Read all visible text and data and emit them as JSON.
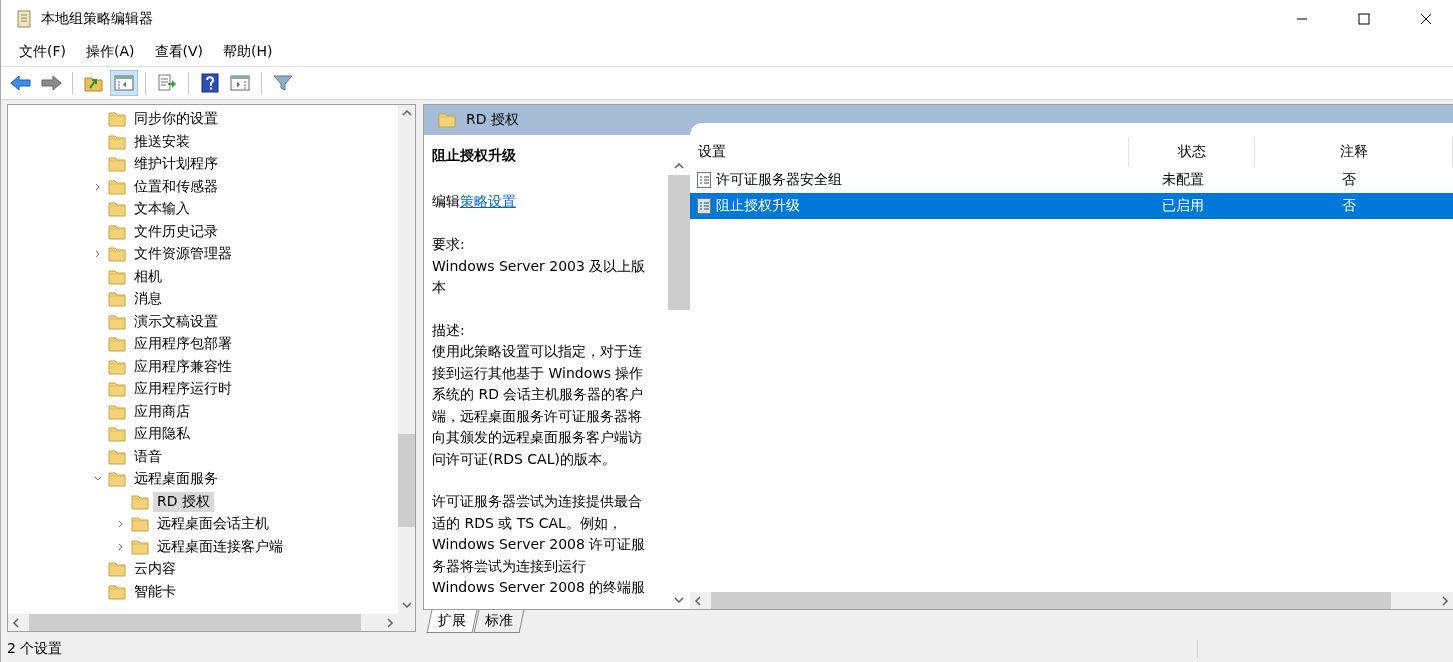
{
  "window": {
    "title": "本地组策略编辑器"
  },
  "menu": [
    "文件(F)",
    "操作(A)",
    "查看(V)",
    "帮助(H)"
  ],
  "toolbar": [
    {
      "kind": "back",
      "pressed": false
    },
    {
      "kind": "forward",
      "pressed": false
    },
    {
      "kind": "separator"
    },
    {
      "kind": "up",
      "pressed": false
    },
    {
      "kind": "tree",
      "pressed": true
    },
    {
      "kind": "separator"
    },
    {
      "kind": "export",
      "pressed": false
    },
    {
      "kind": "separator"
    },
    {
      "kind": "help",
      "pressed": false
    },
    {
      "kind": "actions",
      "pressed": false
    },
    {
      "kind": "separator"
    },
    {
      "kind": "filter",
      "pressed": false
    }
  ],
  "tree": [
    {
      "label": "同步你的设置",
      "selected": false
    },
    {
      "label": "推送安装",
      "selected": false
    },
    {
      "label": "维护计划程序",
      "selected": false
    },
    {
      "label": "位置和传感器",
      "selected": false,
      "expanded": false
    },
    {
      "label": "文本输入",
      "selected": false
    },
    {
      "label": "文件历史记录",
      "selected": false
    },
    {
      "label": "文件资源管理器",
      "selected": false,
      "expanded": false
    },
    {
      "label": "相机",
      "selected": false
    },
    {
      "label": "消息",
      "selected": false
    },
    {
      "label": "演示文稿设置",
      "selected": false
    },
    {
      "label": "应用程序包部署",
      "selected": false
    },
    {
      "label": "应用程序兼容性",
      "selected": false
    },
    {
      "label": "应用程序运行时",
      "selected": false
    },
    {
      "label": "应用商店",
      "selected": false
    },
    {
      "label": "应用隐私",
      "selected": false
    },
    {
      "label": "语音",
      "selected": false
    },
    {
      "label": "远程桌面服务",
      "selected": false,
      "expanded": true,
      "children": [
        {
          "label": "RD 授权",
          "selected": true
        },
        {
          "label": "远程桌面会话主机",
          "selected": false,
          "expanded": false
        },
        {
          "label": "远程桌面连接客户端",
          "selected": false,
          "expanded": false
        }
      ]
    },
    {
      "label": "云内容",
      "selected": false
    },
    {
      "label": "智能卡",
      "selected": false
    }
  ],
  "details": {
    "header": "RD 授权",
    "policy_title": "阻止授权升级",
    "edit_prefix": "编辑",
    "edit_link": "策略设置",
    "paragraphs": [
      {
        "lines": [
          "要求:",
          "Windows Server 2003 及以上版",
          "本"
        ]
      },
      {
        "lines": [
          "描述:",
          "使用此策略设置可以指定，对于连",
          "接到运行其他基于 Windows 操作",
          "系统的 RD 会话主机服务器的客户",
          "端，远程桌面服务许可证服务器将",
          "向其颁发的远程桌面服务客户端访",
          "问许可证(RDS CAL)的版本。"
        ]
      },
      {
        "lines": [
          "许可证服务器尝试为连接提供最合",
          "适的 RDS 或 TS CAL。例如，",
          "Windows Server 2008 许可证服",
          "务器将尝试为连接到运行",
          "Windows Server 2008 的终端服"
        ]
      }
    ]
  },
  "list": {
    "columns": [
      "设置",
      "状态",
      "注释"
    ],
    "rows": [
      {
        "setting": "许可证服务器安全组",
        "state": "未配置",
        "comment": "否",
        "selected": false
      },
      {
        "setting": "阻止授权升级",
        "state": "已启用",
        "comment": "否",
        "selected": true
      }
    ]
  },
  "tabs": [
    {
      "label": "扩展",
      "selected": true
    },
    {
      "label": "标准",
      "selected": false
    }
  ],
  "status_bar": {
    "text": "2 个设置"
  }
}
